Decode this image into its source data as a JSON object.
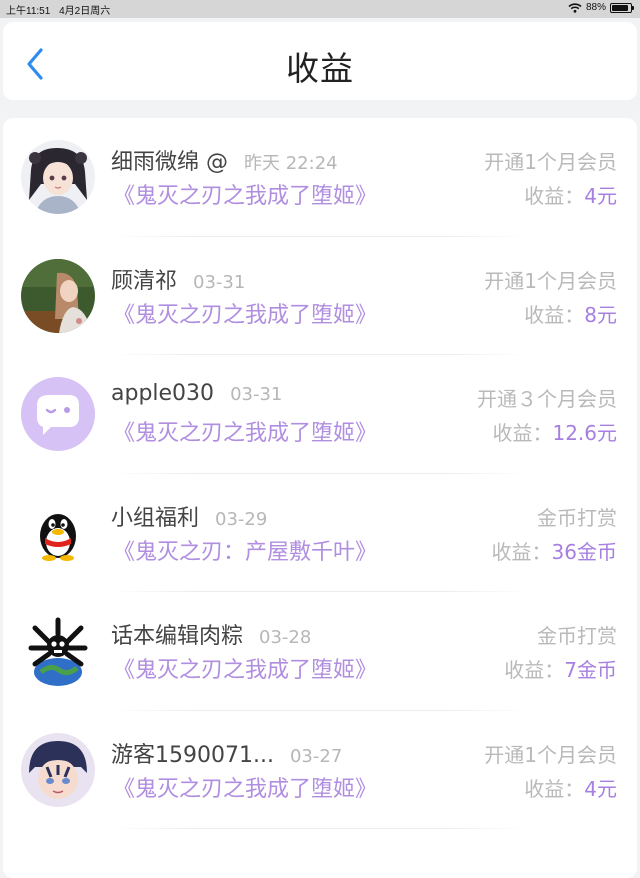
{
  "status_bar": {
    "time": "上午11:51",
    "date": "4月2日周六",
    "battery_text": "88%",
    "battery_level": 0.88
  },
  "header": {
    "title": "收益"
  },
  "colors": {
    "accent": "#2e8cf0",
    "book_purple": "#b08ee0",
    "amount_purple": "#a77fe0"
  },
  "earning_label": "收益：",
  "rows": [
    {
      "avatar": "anime-girl-avatar",
      "name": "细雨微绵 @",
      "date": "昨天 22:24",
      "book": "《鬼灭之刃之我成了堕姬》",
      "type": "开通1个月会员",
      "amount": "4元"
    },
    {
      "avatar": "photo-girl-avatar",
      "name": "顾清祁",
      "date": "03-31",
      "book": "《鬼灭之刃之我成了堕姬》",
      "type": "开通1个月会员",
      "amount": "8元"
    },
    {
      "avatar": "chat-bubble-avatar",
      "name": "apple030",
      "date": "03-31",
      "book": "《鬼灭之刃之我成了堕姬》",
      "type": "开通３个月会员",
      "amount": "12.6元"
    },
    {
      "avatar": "qq-penguin-avatar",
      "name": "小组福利",
      "date": "03-29",
      "book": "《鬼灭之刃：产屋敷千叶》",
      "type": "金币打赏",
      "amount": "36金币"
    },
    {
      "avatar": "skull-earth-avatar",
      "name": "话本编辑肉粽",
      "date": "03-28",
      "book": "《鬼灭之刃之我成了堕姬》",
      "type": "金币打赏",
      "amount": "7金币"
    },
    {
      "avatar": "anime-boy-avatar",
      "name": "游客1590071...",
      "date": "03-27",
      "book": "《鬼灭之刃之我成了堕姬》",
      "type": "开通1个月会员",
      "amount": "4元"
    }
  ]
}
